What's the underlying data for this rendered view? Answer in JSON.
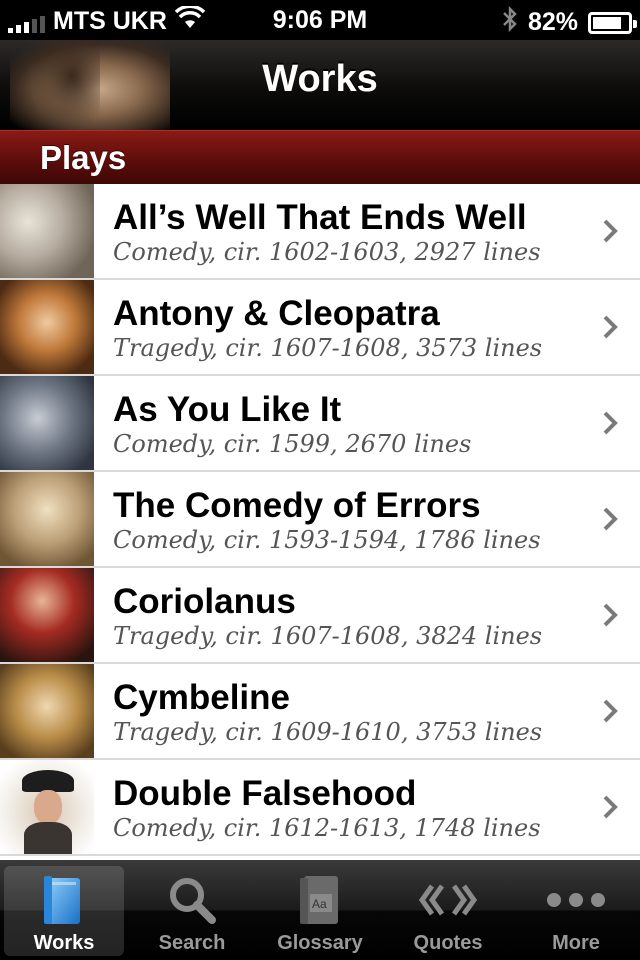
{
  "status_bar": {
    "carrier": "MTS UKR",
    "time": "9:06 PM",
    "battery_percent": "82%",
    "battery_level": 0.82
  },
  "nav": {
    "title": "Works"
  },
  "section": {
    "title": "Plays"
  },
  "plays": [
    {
      "title": "All’s Well That Ends Well",
      "subtitle": "Comedy, cir. 1602-1603, 2927 lines"
    },
    {
      "title": "Antony & Cleopatra",
      "subtitle": "Tragedy, cir. 1607-1608, 3573 lines"
    },
    {
      "title": "As You Like It",
      "subtitle": "Comedy, cir. 1599, 2670 lines"
    },
    {
      "title": "The Comedy of Errors",
      "subtitle": "Comedy, cir. 1593-1594, 1786 lines"
    },
    {
      "title": "Coriolanus",
      "subtitle": "Tragedy, cir. 1607-1608, 3824 lines"
    },
    {
      "title": "Cymbeline",
      "subtitle": "Tragedy, cir. 1609-1610, 3753 lines"
    },
    {
      "title": "Double Falsehood",
      "subtitle": "Comedy, cir. 1612-1613, 1748 lines"
    }
  ],
  "tabs": [
    {
      "label": "Works",
      "icon": "book-icon",
      "selected": true
    },
    {
      "label": "Search",
      "icon": "search-icon",
      "selected": false
    },
    {
      "label": "Glossary",
      "icon": "dictionary-icon",
      "selected": false
    },
    {
      "label": "Quotes",
      "icon": "quotes-icon",
      "selected": false
    },
    {
      "label": "More",
      "icon": "more-icon",
      "selected": false
    }
  ],
  "colors": {
    "section_header": "#6e1210",
    "tab_selected_icon": "#3aa0e8"
  }
}
